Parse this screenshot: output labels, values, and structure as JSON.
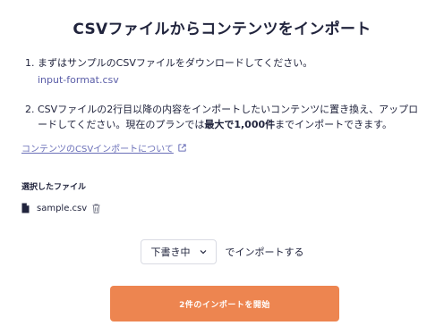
{
  "dialog": {
    "title": "CSVファイルからコンテンツをインポート"
  },
  "steps": [
    {
      "number": "1.",
      "text": "まずはサンプルのCSVファイルをダウンロードしてください。",
      "link_text": "input-format.csv"
    },
    {
      "number": "2.",
      "text_before": "CSVファイルの2行目以降の内容をインポートしたいコンテンツに置き換え、アップロードしてください。現在のプランでは",
      "text_bold": "最大で1,000件",
      "text_after": "までインポートできます。"
    }
  ],
  "help": {
    "link_text": "コンテンツのCSVインポートについて",
    "icon": "external-link-icon"
  },
  "selected_file": {
    "label": "選択したファイル",
    "file_name": "sample.csv",
    "file_icon": "file-icon",
    "delete_icon": "trash-icon"
  },
  "import_options": {
    "status_selected": "下書き中",
    "suffix": "でインポートする"
  },
  "actions": {
    "start_label": "2件のインポートを開始"
  },
  "colors": {
    "primary_button": "#ed8550",
    "link": "#5b5ea8",
    "text": "#21243d"
  }
}
